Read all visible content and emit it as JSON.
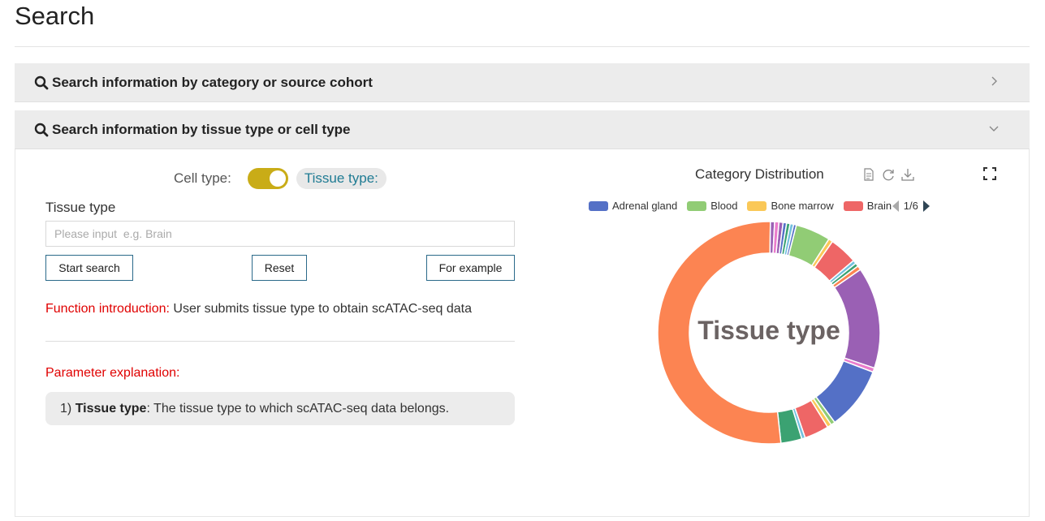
{
  "page": {
    "title": "Search"
  },
  "panels": [
    {
      "title": "Search information by category or source cohort",
      "expanded": false
    },
    {
      "title": "Search information by tissue type or cell type",
      "expanded": true
    }
  ],
  "toggle": {
    "cell_label": "Cell type:",
    "tissue_label": "Tissue type:",
    "state": "tissue",
    "color": "#c9ac17"
  },
  "form": {
    "field_label": "Tissue type",
    "input_placeholder": "Please input  e.g. Brain",
    "input_value": "",
    "start_label": "Start search",
    "reset_label": "Reset",
    "example_label": "For example"
  },
  "intro": {
    "label": "Function introduction:",
    "text": " User submits tissue type to obtain scATAC-seq data"
  },
  "params": {
    "title": "Parameter explanation:",
    "items": [
      {
        "num": "1)",
        "name": "Tissue type",
        "desc": ": The tissue type to which scATAC-seq data belongs."
      }
    ]
  },
  "chart": {
    "title": "Category Distribution",
    "center_label": "Tissue type",
    "legend": [
      {
        "name": "Adrenal gland",
        "color": "#5470c6"
      },
      {
        "name": "Blood",
        "color": "#91cc75"
      },
      {
        "name": "Bone marrow",
        "color": "#fac858"
      },
      {
        "name": "Brain",
        "color": "#ee6666"
      }
    ],
    "legend_page": "1/6",
    "icons": [
      "data-view-icon",
      "refresh-icon",
      "download-icon",
      "fullscreen-icon"
    ]
  },
  "chart_data": {
    "type": "pie",
    "donut": true,
    "slices": [
      {
        "value": 0.6,
        "color": "#9a60b4"
      },
      {
        "value": 0.5,
        "color": "#5470c6"
      },
      {
        "value": 0.5,
        "color": "#3ba272"
      },
      {
        "value": 0.5,
        "color": "#73c0de"
      },
      {
        "value": 0.4,
        "color": "#5470c6"
      },
      {
        "value": 5.0,
        "color": "#91cc75"
      },
      {
        "value": 0.6,
        "color": "#fac858"
      },
      {
        "value": 4.0,
        "color": "#ee6666"
      },
      {
        "value": 0.5,
        "color": "#73c0de"
      },
      {
        "value": 0.5,
        "color": "#3ba272"
      },
      {
        "value": 0.6,
        "color": "#fc8452"
      },
      {
        "value": 14.5,
        "color": "#9a60b4"
      },
      {
        "value": 0.6,
        "color": "#ea7ccc"
      },
      {
        "value": 9.0,
        "color": "#5470c6"
      },
      {
        "value": 0.6,
        "color": "#91cc75"
      },
      {
        "value": 0.6,
        "color": "#fac858"
      },
      {
        "value": 3.5,
        "color": "#ee6666"
      },
      {
        "value": 0.5,
        "color": "#73c0de"
      },
      {
        "value": 3.0,
        "color": "#3ba272"
      },
      {
        "value": 51.0,
        "color": "#fc8452"
      },
      {
        "value": 0.6,
        "color": "#9a60b4"
      },
      {
        "value": 0.6,
        "color": "#ea7ccc"
      }
    ]
  }
}
